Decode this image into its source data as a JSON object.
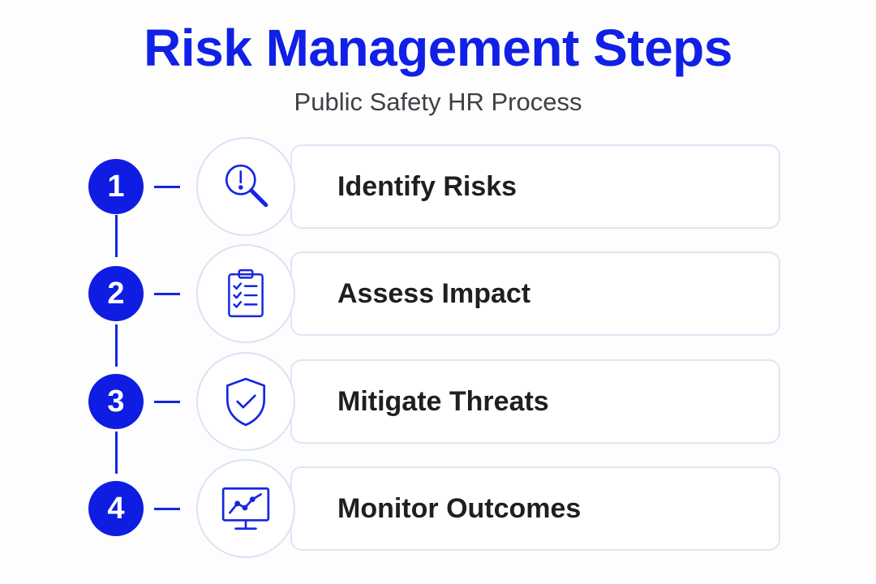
{
  "title": "Risk Management Steps",
  "subtitle": "Public Safety HR Process",
  "colors": {
    "accent": "#1020e6",
    "card_border": "#dde6f6",
    "text": "#1f1f23"
  },
  "steps": [
    {
      "number": "1",
      "label": "Identify Risks",
      "icon": "magnifier-alert-icon"
    },
    {
      "number": "2",
      "label": "Assess Impact",
      "icon": "clipboard-checklist-icon"
    },
    {
      "number": "3",
      "label": "Mitigate Threats",
      "icon": "shield-check-icon"
    },
    {
      "number": "4",
      "label": "Monitor Outcomes",
      "icon": "monitor-chart-icon"
    }
  ]
}
